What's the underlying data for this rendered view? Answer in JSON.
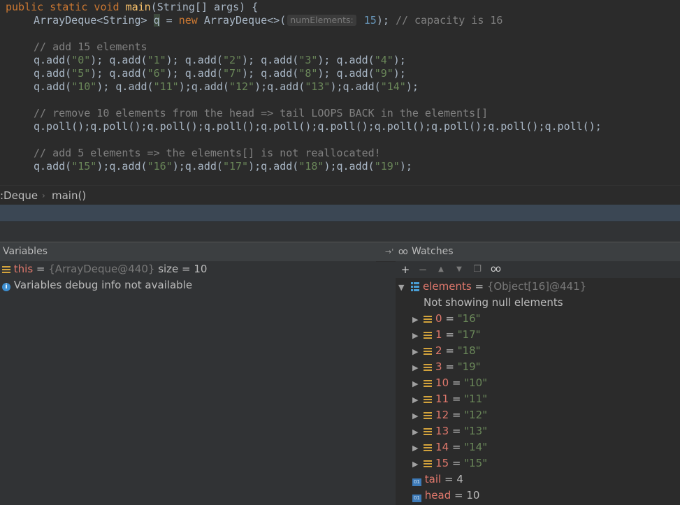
{
  "editor": {
    "lines": {
      "l1": {
        "a": "public static void ",
        "b": "main",
        "c": "(String[] args) {"
      },
      "l2": {
        "a": "ArrayDeque<String> ",
        "b": "q",
        "c": " = ",
        "d": "new",
        "e": " ArrayDeque<>(",
        "hint": "numElements:",
        "num": " 15",
        "f": "); ",
        "cmt": "// capacity is 16"
      },
      "l4": "// add 15 elements",
      "l5": {
        "p1": "q.add(",
        "s1": "\"0\"",
        "p2": "); q.add(",
        "s2": "\"1\"",
        "p3": "); q.add(",
        "s3": "\"2\"",
        "p4": "); q.add(",
        "s4": "\"3\"",
        "p5": "); q.add(",
        "s5": "\"4\"",
        "p6": ");"
      },
      "l6": {
        "p1": "q.add(",
        "s1": "\"5\"",
        "p2": "); q.add(",
        "s2": "\"6\"",
        "p3": "); q.add(",
        "s3": "\"7\"",
        "p4": "); q.add(",
        "s4": "\"8\"",
        "p5": "); q.add(",
        "s5": "\"9\"",
        "p6": ");"
      },
      "l7": {
        "p1": "q.add(",
        "s1": "\"10\"",
        "p2": "); q.add(",
        "s2": "\"11\"",
        "p3": ");q.add(",
        "s3": "\"12\"",
        "p4": ");q.add(",
        "s4": "\"13\"",
        "p5": ");q.add(",
        "s5": "\"14\"",
        "p6": ");"
      },
      "l9": "// remove 10 elements from the head => tail LOOPS BACK in the elements[]",
      "l10": "q.poll();q.poll();q.poll();q.poll();q.poll();q.poll();q.poll();q.poll();q.poll();q.poll();",
      "l12": "// add 5 elements => the elements[] is not reallocated!",
      "l13": {
        "p1": "q.add(",
        "s1": "\"15\"",
        "p2": ");q.add(",
        "s2": "\"16\"",
        "p3": ");q.add(",
        "s3": "\"17\"",
        "p4": ");q.add(",
        "s4": "\"18\"",
        "p5": ");q.add(",
        "s5": "\"19\"",
        "p6": ");"
      }
    }
  },
  "breadcrumb": {
    "class": ":Deque",
    "sep": "›",
    "method": "main()"
  },
  "variables": {
    "title": "Variables",
    "this_name": "this",
    "this_eq": " = ",
    "this_value": "{ArrayDeque@440}",
    "this_size": "  size = 10",
    "info": "Variables debug info not available"
  },
  "watches": {
    "title": "Watches",
    "pin": "→'",
    "glasses": "oo",
    "toolbar": {
      "add": "+",
      "remove": "−",
      "up": "▲",
      "down": "▼",
      "copy": "❐",
      "glasses": "oo"
    },
    "root": {
      "name": "elements",
      "eq": " = ",
      "value": "{Object[16]@441}"
    },
    "note": "Not showing null elements",
    "items": [
      {
        "index": "0",
        "value": "\"16\""
      },
      {
        "index": "1",
        "value": "\"17\""
      },
      {
        "index": "2",
        "value": "\"18\""
      },
      {
        "index": "3",
        "value": "\"19\""
      },
      {
        "index": "10",
        "value": "\"10\""
      },
      {
        "index": "11",
        "value": "\"11\""
      },
      {
        "index": "12",
        "value": "\"12\""
      },
      {
        "index": "13",
        "value": "\"13\""
      },
      {
        "index": "14",
        "value": "\"14\""
      },
      {
        "index": "15",
        "value": "\"15\""
      }
    ],
    "tail": {
      "name": "tail",
      "eq": " = ",
      "value": "4"
    },
    "head": {
      "name": "head",
      "eq": " = ",
      "value": "10"
    }
  },
  "colors": {
    "accent_strip": "#3b4754",
    "var_name": "#e0786c",
    "string": "#6a8759"
  }
}
